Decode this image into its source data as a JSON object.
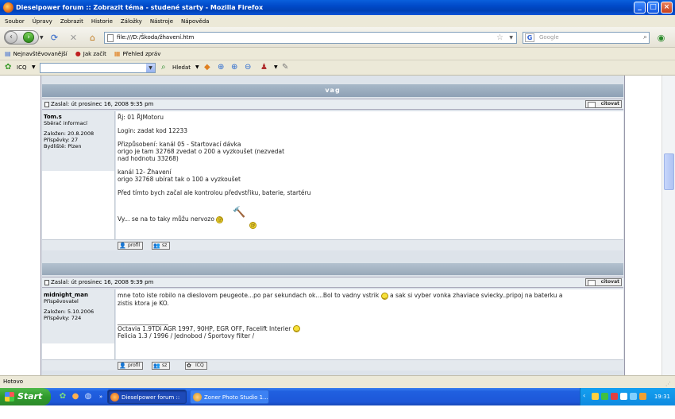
{
  "window": {
    "title": "Dieselpower forum :: Zobrazit téma - studené starty - Mozilla Firefox"
  },
  "menu": [
    "Soubor",
    "Úpravy",
    "Zobrazit",
    "Historie",
    "Záložky",
    "Nástroje",
    "Nápověda"
  ],
  "nav": {
    "url": "file:///D:/Škoda/žhavení.htm",
    "search_placeholder": "Google"
  },
  "bookmarks": [
    "Nejnavštěvovanější",
    "Jak začít",
    "Přehled zpráv"
  ],
  "icq": {
    "label": "ICQ",
    "search_label": "Hledat"
  },
  "forum": {
    "category": "vag",
    "posts": [
      {
        "header": "Zaslal: út prosinec 16, 2008 9:35 pm",
        "quote_label": "citovat",
        "author": {
          "name": "Tom.s",
          "rank": "Sběrač informací",
          "joined": "Založen: 20.8.2008",
          "posts": "Příspěvky: 27",
          "location": "Bydliště: Plzen"
        },
        "lines": [
          "Řj: 01 ŘJMotoru",
          "Login: zadat kod 12233",
          "Přizpůsobení: kanál 05 - Startovací dávka",
          "origo je tam 32768 zvedat o 200 a vyzkoušet (nezvedat",
          "nad hodnotu 33268)",
          "kanál 12- Žhavení",
          "origo 32768 ubírat tak o 100 a vyzkoušet",
          "Před tímto bych začal ale kontrolou předvstřiku, baterie, startéru",
          "Vy... se na to taky můžu nervozo"
        ],
        "buttons": [
          "profil",
          "sz"
        ]
      },
      {
        "header": "Zaslal: út prosinec 16, 2008 9:39 pm",
        "quote_label": "citovat",
        "author": {
          "name": "midnight_man",
          "rank": "Přispěvovatel",
          "joined": "Založen: 5.10.2006",
          "posts": "Příspěvky: 724"
        },
        "text_a": "mne toto iste robilo na dieslovom peugeote...po par sekundach ok....Bol to vadny vstrik",
        "text_b": "a sak si vyber vonka zhaviace sviecky..pripoj na baterku a",
        "text_c": "zistis ktora je KO.",
        "sig_rule": "_________________",
        "sig1": "Octavia 1.9TDi AGR 1997, 90HP, EGR OFF, Facelift Interier",
        "sig2": "Felicia 1.3 / 1996 / Jednobod / Športovy filter /",
        "buttons": [
          "profil",
          "sz",
          "ICQ"
        ]
      }
    ]
  },
  "status": "Hotovo",
  "taskbar": {
    "start": "Start",
    "tasks": [
      "Dieselpower forum :: ...",
      "Zoner Photo Studio 1..."
    ],
    "clock": "19:31"
  }
}
